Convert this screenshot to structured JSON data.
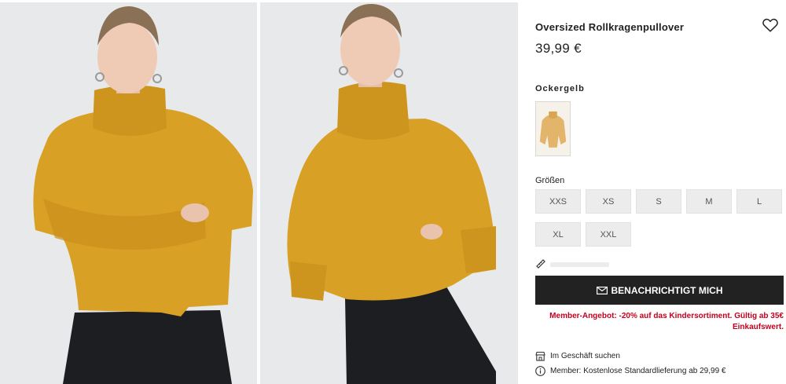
{
  "product": {
    "title": "Oversized Rollkragenpullover",
    "price": "39,99 €"
  },
  "color": {
    "label": "Ockergelb",
    "swatch_hex": "#e3b56a"
  },
  "sizes": {
    "label": "Größen",
    "options": [
      "XXS",
      "XS",
      "S",
      "M",
      "L",
      "XL",
      "XXL"
    ]
  },
  "actions": {
    "notify_label": "BENACHRICHTIGT MICH"
  },
  "promo": {
    "text": "Member-Angebot: -20% auf das Kindersortiment. Gültig ab 35€ Einkaufswert."
  },
  "info": {
    "store_label": "Im Geschäft suchen",
    "shipping_label": "Member: Kostenlose Standardlieferung ab 29,99 €"
  },
  "colors": {
    "sweater": "#d9a026",
    "skirt": "#1d1e22",
    "background": "#e9eaec",
    "promo_red": "#c4001e",
    "button_dark": "#222222"
  }
}
